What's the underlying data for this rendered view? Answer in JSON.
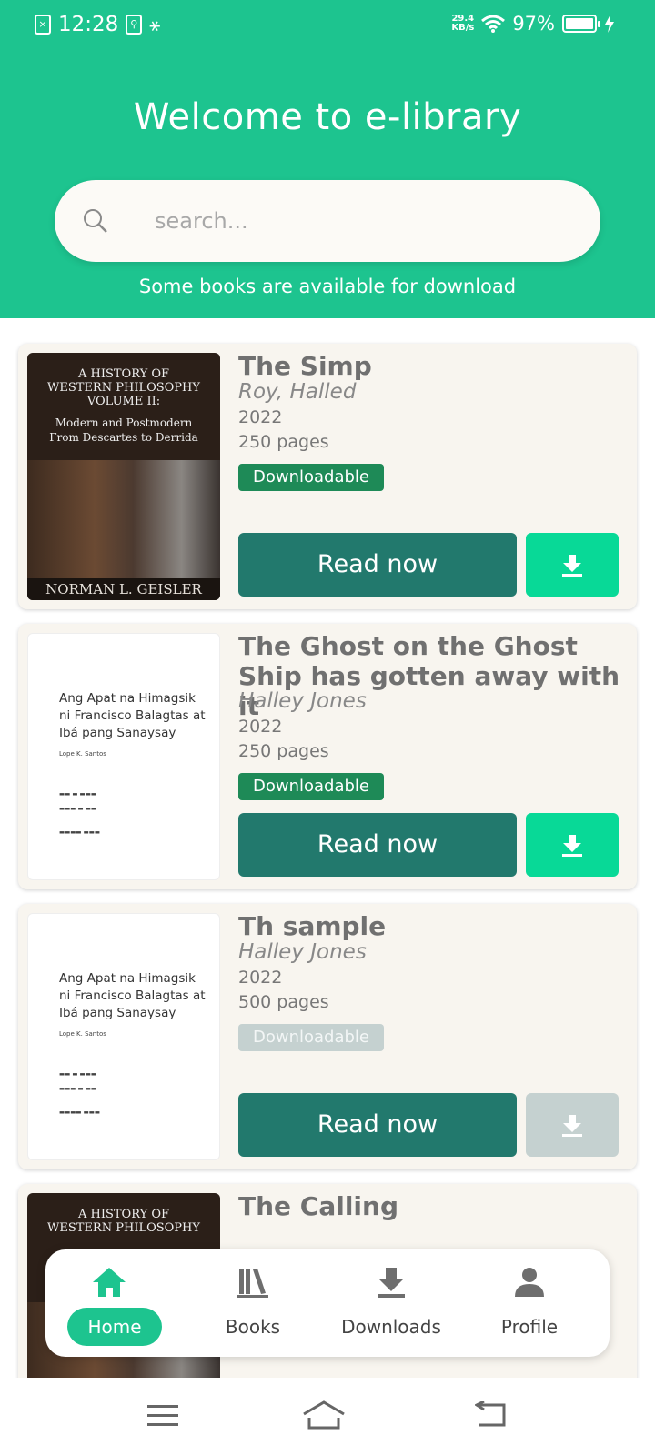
{
  "status_bar": {
    "time": "12:28",
    "net_speed_top": "29.4",
    "net_speed_unit": "KB/s",
    "battery": "97%"
  },
  "header": {
    "title": "Welcome to e-library",
    "search_placeholder": "search...",
    "subtitle": "Some books are available for download"
  },
  "books": [
    {
      "title": "The Simp",
      "author": "Roy, Halled",
      "year": "2022",
      "pages": "250 pages",
      "badge": "Downloadable",
      "downloadable": true,
      "read_label": "Read now",
      "cover": {
        "line1": "A HISTORY OF",
        "line2": "WESTERN PHILOSOPHY",
        "line3": "VOLUME II:",
        "line4": "Modern and Postmodern",
        "line5": "From Descartes to Derrida",
        "author": "NORMAN L. GEISLER"
      }
    },
    {
      "title": "The Ghost on the Ghost Ship has gotten away with it",
      "author": "Halley Jones",
      "year": "2022",
      "pages": "250 pages",
      "badge": "Downloadable",
      "downloadable": true,
      "read_label": "Read now",
      "cover": {
        "line1": "Ang Apat na Himagsik",
        "line2": "ni  Francisco Balagtas at",
        "line3": "Ibá pang Sanaysay",
        "author": "Lope K. Santos"
      }
    },
    {
      "title": "Th sample",
      "author": "Halley Jones",
      "year": "2022",
      "pages": "500 pages",
      "badge": "Downloadable",
      "downloadable": false,
      "read_label": "Read now",
      "cover": {
        "line1": "Ang Apat na Himagsik",
        "line2": "ni  Francisco Balagtas at",
        "line3": "Ibá pang Sanaysay",
        "author": "Lope K. Santos"
      }
    },
    {
      "title": "The Calling",
      "cover": {
        "line1": "A HISTORY OF",
        "line2": "WESTERN PHILOSOPHY"
      }
    }
  ],
  "bottom_nav": [
    {
      "label": "Home",
      "icon": "home-icon",
      "active": true
    },
    {
      "label": "Books",
      "icon": "books-icon",
      "active": false
    },
    {
      "label": "Downloads",
      "icon": "download-icon",
      "active": false
    },
    {
      "label": "Profile",
      "icon": "person-icon",
      "active": false
    }
  ],
  "colors": {
    "brand": "#1dc48f",
    "read_button": "#22796d",
    "download_button": "#08d997",
    "disabled": "#c5d1d0",
    "badge": "#1e8a57"
  }
}
